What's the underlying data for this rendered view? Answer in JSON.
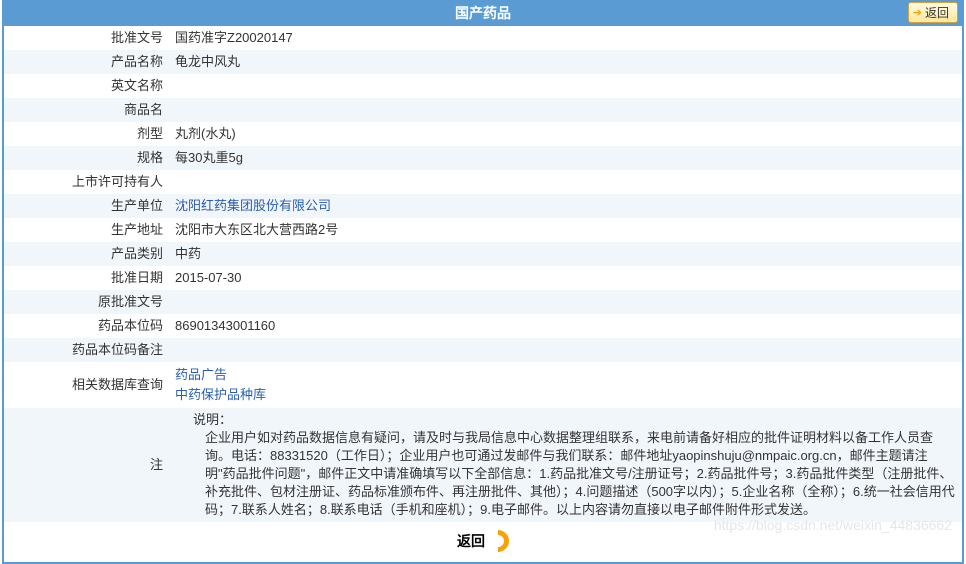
{
  "header": {
    "title": "国产药品",
    "back_label": "返回"
  },
  "rows": [
    {
      "label": "批准文号",
      "value": "国药准字Z20020147"
    },
    {
      "label": "产品名称",
      "value": "龟龙中风丸"
    },
    {
      "label": "英文名称",
      "value": ""
    },
    {
      "label": "商品名",
      "value": ""
    },
    {
      "label": "剂型",
      "value": "丸剂(水丸)"
    },
    {
      "label": "规格",
      "value": "每30丸重5g"
    },
    {
      "label": "上市许可持有人",
      "value": ""
    },
    {
      "label": "生产单位",
      "value": "沈阳红药集团股份有限公司",
      "is_link": true
    },
    {
      "label": "生产地址",
      "value": "沈阳市大东区北大营西路2号"
    },
    {
      "label": "产品类别",
      "value": "中药"
    },
    {
      "label": "批准日期",
      "value": "2015-07-30"
    },
    {
      "label": "原批准文号",
      "value": ""
    },
    {
      "label": "药品本位码",
      "value": "86901343001160"
    },
    {
      "label": "药品本位码备注",
      "value": ""
    }
  ],
  "related": {
    "label": "相关数据库查询",
    "links": [
      "药品广告",
      "中药保护品种库"
    ]
  },
  "note": {
    "label": "注",
    "title": "说明：",
    "body": "企业用户如对药品数据信息有疑问，请及时与我局信息中心数据整理组联系，来电前请备好相应的批件证明材料以备工作人员查询。电话：88331520（工作日）；企业用户也可通过发邮件与我们联系：邮件地址yaopinshuju@nmpaic.org.cn，邮件主题请注明\"药品批件问题\"，邮件正文中请准确填写以下全部信息：1.药品批准文号/注册证号；2.药品批件号；3.药品批件类型（注册批件、补充批件、包材注册证、药品标准颁布件、再注册批件、其他）；4.问题描述（500字以内）；5.企业名称（全称）；6.统一社会信用代码；7.联系人姓名；8.联系电话（手机和座机）；9.电子邮件。以上内容请勿直接以电子邮件附件形式发送。"
  },
  "footer": {
    "back_label": "返回"
  },
  "watermark": "https://blog.csdn.net/weixin_44836662"
}
